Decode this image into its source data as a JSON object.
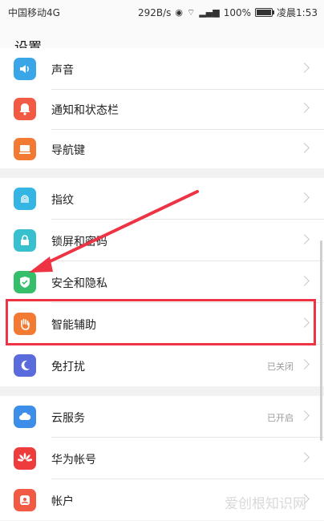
{
  "status_bar": {
    "carrier": "中国移动4G",
    "speed": "292B/s",
    "battery_percent": "100%",
    "battery_level": 1.0,
    "time": "凌晨1:53"
  },
  "header": {
    "title": "设置"
  },
  "groups": [
    {
      "items": [
        {
          "label": "声音",
          "icon": "sound-icon",
          "color": "#3aa6e8"
        },
        {
          "label": "通知和状态栏",
          "icon": "bell-icon",
          "color": "#f25a43"
        },
        {
          "label": "导航键",
          "icon": "navigation-key-icon",
          "color": "#f27a32"
        }
      ]
    },
    {
      "items": [
        {
          "label": "指纹",
          "icon": "fingerprint-icon",
          "color": "#34b5e3"
        },
        {
          "label": "锁屏和密码",
          "icon": "lock-icon",
          "color": "#38c0cf"
        },
        {
          "label": "安全和隐私",
          "icon": "shield-icon",
          "color": "#36bf6a"
        },
        {
          "label": "智能辅助",
          "icon": "hand-icon",
          "color": "#f27a32"
        },
        {
          "label": "免打扰",
          "icon": "moon-icon",
          "color": "#5a6bdb",
          "value": "已关闭"
        }
      ]
    },
    {
      "items": [
        {
          "label": "云服务",
          "icon": "cloud-icon",
          "color": "#3d8ee8",
          "value": "已开启"
        },
        {
          "label": "华为帐号",
          "icon": "huawei-icon",
          "color": "#ee3b3b"
        },
        {
          "label": "帐户",
          "icon": "account-icon",
          "color": "#f25a43"
        }
      ]
    }
  ],
  "watermark": "爱创根知识网"
}
